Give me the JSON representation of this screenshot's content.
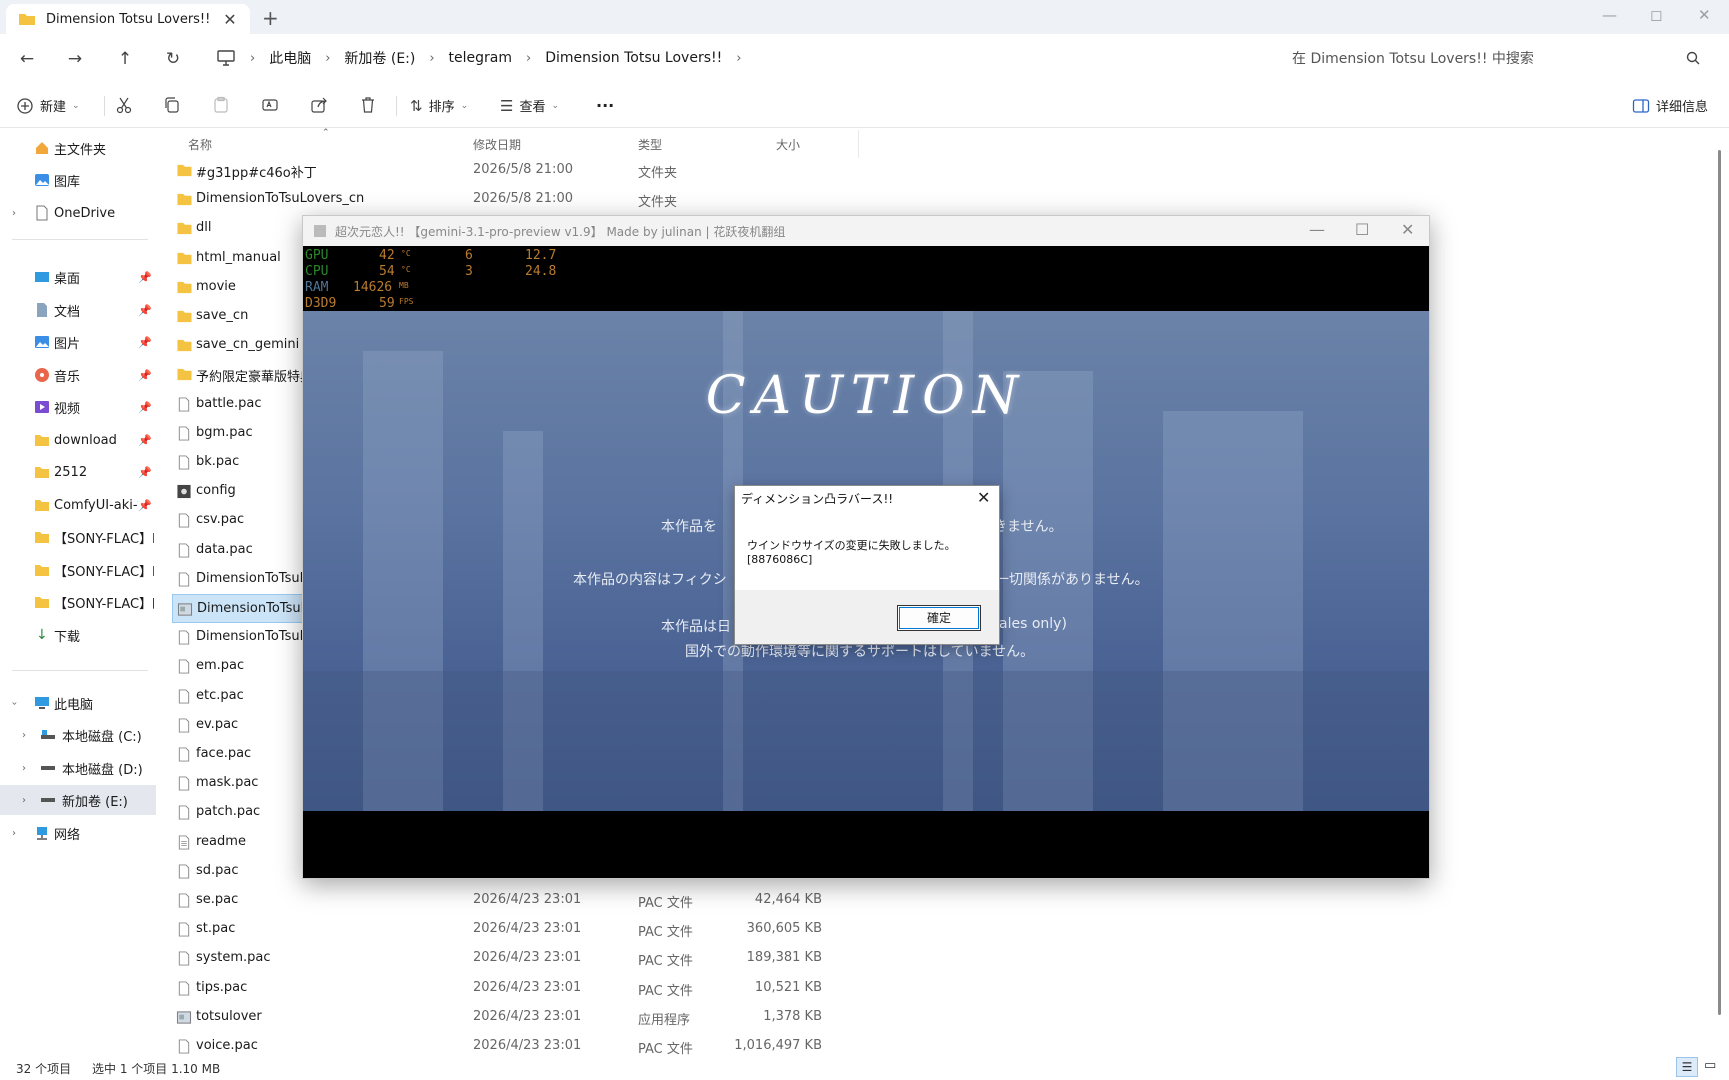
{
  "tab": {
    "title": "Dimension Totsu Lovers!!",
    "close": "✕",
    "new": "+"
  },
  "window_controls": {
    "minimize": "—",
    "maximize": "◻",
    "close": "✕"
  },
  "breadcrumb": [
    "此电脑",
    "新加卷 (E:)",
    "telegram",
    "Dimension Totsu Lovers!!"
  ],
  "search": {
    "placeholder": "在 Dimension Totsu Lovers!! 中搜索"
  },
  "toolbar": {
    "new": "新建",
    "sort": "排序",
    "view": "查看",
    "details": "详细信息",
    "more": "···"
  },
  "sidebar": {
    "home": "主文件夹",
    "gallery": "图库",
    "onedrive": "OneDrive",
    "desktop": "桌面",
    "documents": "文档",
    "pictures": "图片",
    "music": "音乐",
    "videos": "视频",
    "download": "download",
    "f2512": "2512",
    "comfy": "ComfyUI-aki-v",
    "sony1": "【SONY-FLAC】L",
    "sony2": "【SONY-FLAC】M",
    "sony3": "【SONY-FLAC】四",
    "downloads": "下载",
    "thispc": "此电脑",
    "c": "本地磁盘 (C:)",
    "d": "本地磁盘 (D:)",
    "e": "新加卷 (E:)",
    "network": "网络"
  },
  "columns": {
    "name": "名称",
    "date": "修改日期",
    "type": "类型",
    "size": "大小"
  },
  "files": [
    {
      "name": "#g31pp#c46o补丁",
      "date": "2026/5/8 21:00",
      "type": "文件夹",
      "size": "",
      "icon": "folder"
    },
    {
      "name": "DimensionToTsuLovers_cn",
      "date": "2026/5/8 21:00",
      "type": "文件夹",
      "size": "",
      "icon": "folder"
    },
    {
      "name": "dll",
      "date": "",
      "type": "",
      "size": "",
      "icon": "folder"
    },
    {
      "name": "html_manual",
      "date": "",
      "type": "",
      "size": "",
      "icon": "folder"
    },
    {
      "name": "movie",
      "date": "",
      "type": "",
      "size": "",
      "icon": "folder"
    },
    {
      "name": "save_cn",
      "date": "",
      "type": "",
      "size": "",
      "icon": "folder"
    },
    {
      "name": "save_cn_gemini",
      "date": "",
      "type": "",
      "size": "",
      "icon": "folder"
    },
    {
      "name": "予約限定豪華版特典",
      "date": "",
      "type": "",
      "size": "",
      "icon": "folder"
    },
    {
      "name": "battle.pac",
      "date": "",
      "type": "",
      "size": "",
      "icon": "file"
    },
    {
      "name": "bgm.pac",
      "date": "",
      "type": "",
      "size": "",
      "icon": "file"
    },
    {
      "name": "bk.pac",
      "date": "",
      "type": "",
      "size": "",
      "icon": "file"
    },
    {
      "name": "config",
      "date": "",
      "type": "",
      "size": "",
      "icon": "gear"
    },
    {
      "name": "csv.pac",
      "date": "",
      "type": "",
      "size": "",
      "icon": "file"
    },
    {
      "name": "data.pac",
      "date": "",
      "type": "",
      "size": "",
      "icon": "file"
    },
    {
      "name": "DimensionToTsuLovers",
      "date": "",
      "type": "",
      "size": "",
      "icon": "file"
    },
    {
      "name": "DimensionToTsuLovers",
      "date": "",
      "type": "",
      "size": "",
      "icon": "app"
    },
    {
      "name": "DimensionToTsuLovers",
      "date": "",
      "type": "",
      "size": "",
      "icon": "file"
    },
    {
      "name": "em.pac",
      "date": "",
      "type": "",
      "size": "",
      "icon": "file"
    },
    {
      "name": "etc.pac",
      "date": "",
      "type": "",
      "size": "",
      "icon": "file"
    },
    {
      "name": "ev.pac",
      "date": "",
      "type": "",
      "size": "",
      "icon": "file"
    },
    {
      "name": "face.pac",
      "date": "",
      "type": "",
      "size": "",
      "icon": "file"
    },
    {
      "name": "mask.pac",
      "date": "",
      "type": "",
      "size": "",
      "icon": "file"
    },
    {
      "name": "patch.pac",
      "date": "",
      "type": "",
      "size": "",
      "icon": "file"
    },
    {
      "name": "readme",
      "date": "",
      "type": "",
      "size": "",
      "icon": "text"
    },
    {
      "name": "sd.pac",
      "date": "",
      "type": "",
      "size": "",
      "icon": "file"
    },
    {
      "name": "se.pac",
      "date": "2026/4/23 23:01",
      "type": "PAC 文件",
      "size": "42,464 KB",
      "icon": "file"
    },
    {
      "name": "st.pac",
      "date": "2026/4/23 23:01",
      "type": "PAC 文件",
      "size": "360,605 KB",
      "icon": "file"
    },
    {
      "name": "system.pac",
      "date": "2026/4/23 23:01",
      "type": "PAC 文件",
      "size": "189,381 KB",
      "icon": "file"
    },
    {
      "name": "tips.pac",
      "date": "2026/4/23 23:01",
      "type": "PAC 文件",
      "size": "10,521 KB",
      "icon": "file"
    },
    {
      "name": "totsulover",
      "date": "2026/4/23 23:01",
      "type": "应用程序",
      "size": "1,378 KB",
      "icon": "app"
    },
    {
      "name": "voice.pac",
      "date": "2026/4/23 23:01",
      "type": "PAC 文件",
      "size": "1,016,497 KB",
      "icon": "file"
    }
  ],
  "statusbar": {
    "count": "32 个项目",
    "selected": "选中 1 个项目  1.10 MB"
  },
  "game": {
    "title": "超次元恋人!! 【gemini-3.1-pro-preview v1.9】 Made by julinan  |  花跃夜机翻组",
    "overlay": {
      "gpu_label": "GPU",
      "gpu_val": "42",
      "gpu_c": "°C",
      "gpu_p": "6",
      "gpu_w": "12.7",
      "cpu_label": "CPU",
      "cpu_val": "54",
      "cpu_c": "°C",
      "cpu_p": "3",
      "cpu_w": "24.8",
      "ram_label": "RAM",
      "ram_val": "14626",
      "ram_unit": "MB",
      "d3d_label": "D3D9",
      "d3d_val": "59",
      "d3d_unit": "FPS"
    },
    "caution": "CAUTION",
    "line1_a": "本作品を",
    "line1_b": "きません。",
    "line2_a": "本作品の内容はフィクシ",
    "line2_b": "一切関係がありません。",
    "line3_a": "本作品は日",
    "line3_b": "ales only)",
    "line4": "国外での動作環境等に関するサポートはしていません。"
  },
  "dialog": {
    "title": "ディメンション凸ラバース!!",
    "message": "ウインドウサイズの変更に失敗しました。",
    "code": "[8876086C]",
    "ok": "確定"
  }
}
